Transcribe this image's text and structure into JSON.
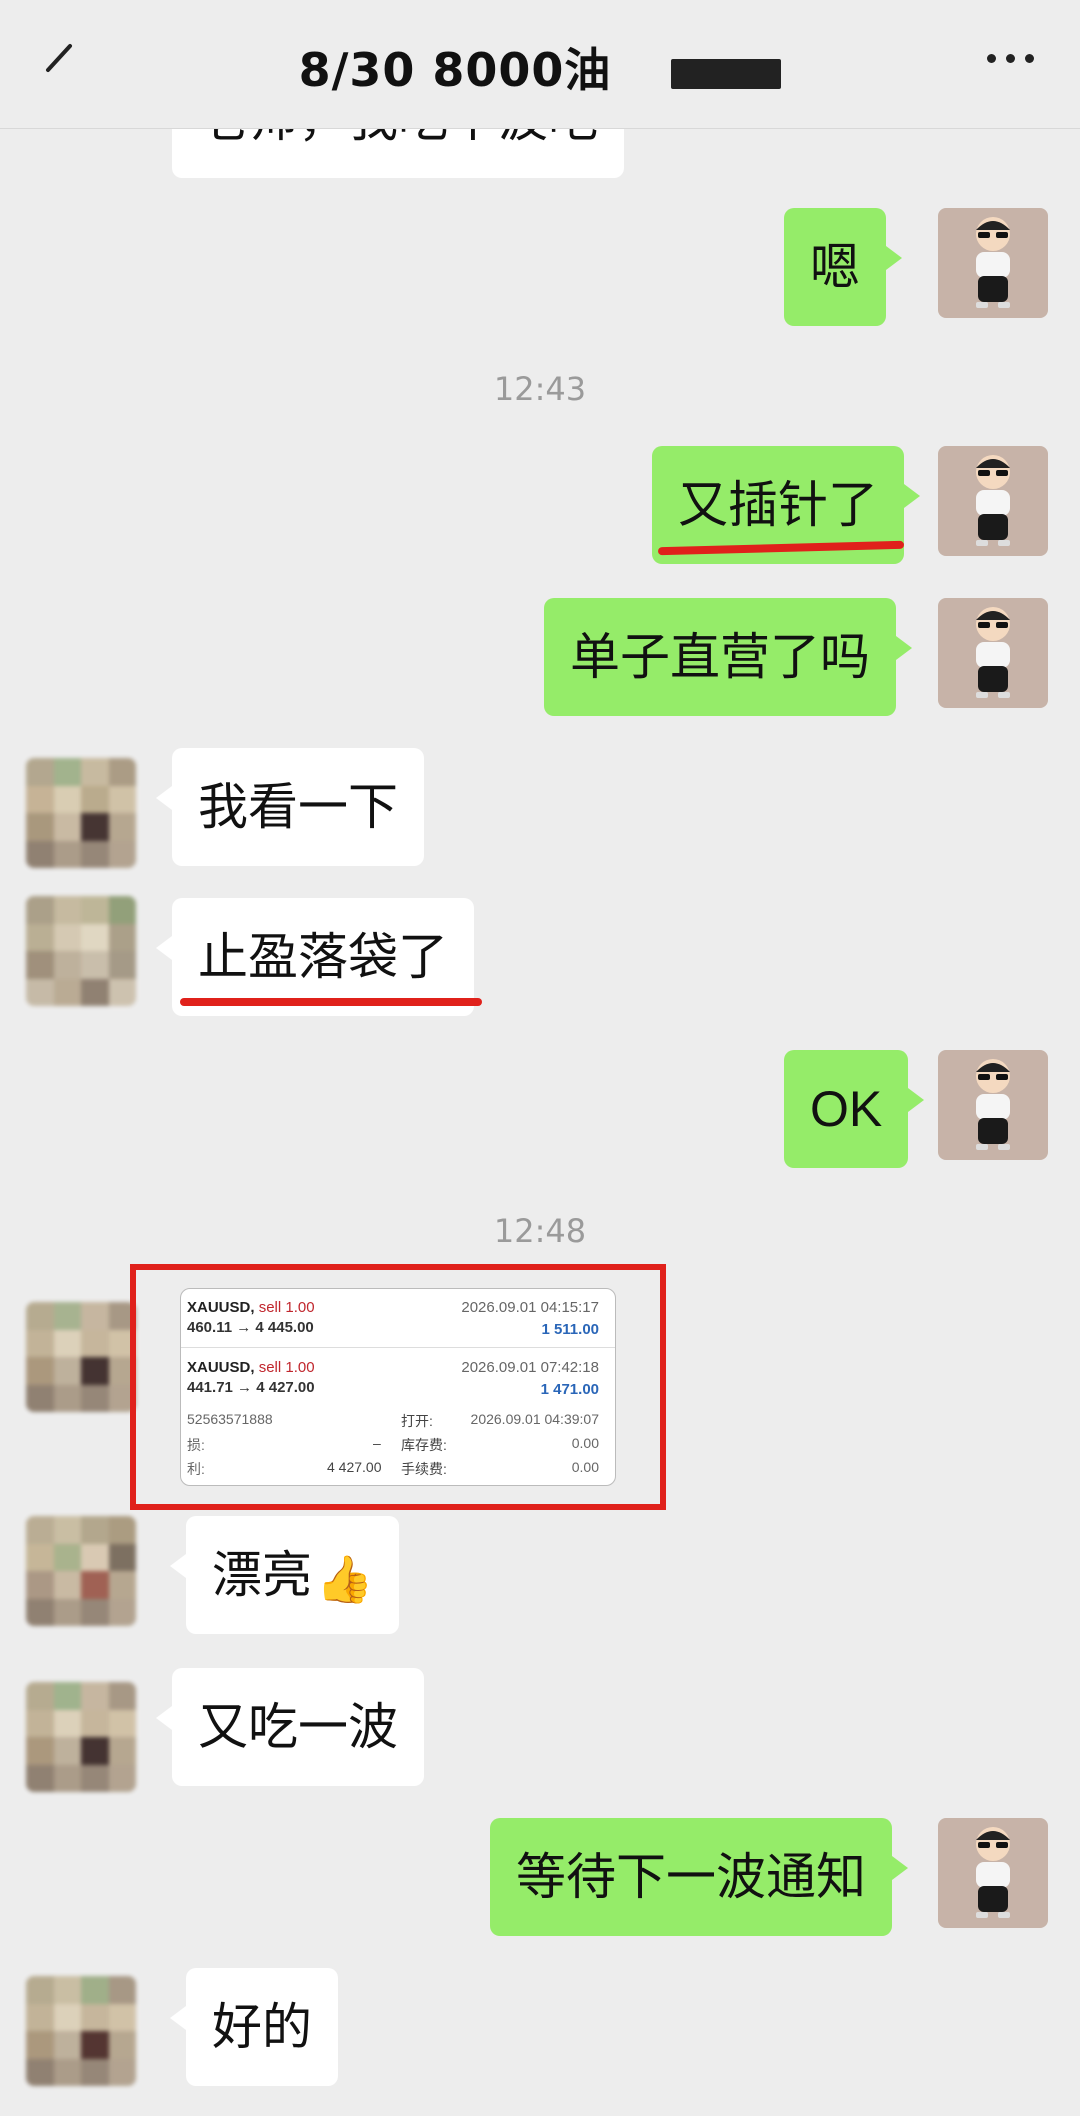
{
  "header": {
    "title": "8/30  8000油"
  },
  "timestamps": [
    "12:43",
    "12:48"
  ],
  "messages": {
    "m0": "老师，我吃个波吧",
    "m1": "嗯",
    "m2": "又插针了",
    "m3": "单子直营了吗",
    "m4": "我看一下",
    "m5": "止盈落袋了",
    "m6": "OK",
    "m8": "漂亮",
    "m9": "又吃一波",
    "m10": "等待下一波通知",
    "m11": "好的"
  },
  "trade_screenshot": {
    "order1": {
      "symbol": "XAUUSD,",
      "side": "sell 1.00",
      "prices": "460.11 → 4 445.00",
      "time": "2026.09.01 04:15:17",
      "profit": "1 511.00"
    },
    "order2": {
      "symbol": "XAUUSD,",
      "side": "sell 1.00",
      "prices": "441.71 → 4 427.00",
      "time": "2026.09.01 07:42:18",
      "profit": "1 471.00"
    },
    "order_id": "52563571888",
    "open_label": "打开:",
    "open_time": "2026.09.01 04:39:07",
    "sl_label": "损:",
    "sl_value": "–",
    "swap_label": "库存费:",
    "swap_value": "0.00",
    "tp_label": "利:",
    "tp_value": "4 427.00",
    "fee_label": "手续费:",
    "fee_value": "0.00"
  },
  "colors": {
    "green_bubble": "#95ec69",
    "background": "#ededed",
    "annotation_red": "#e0211b"
  }
}
